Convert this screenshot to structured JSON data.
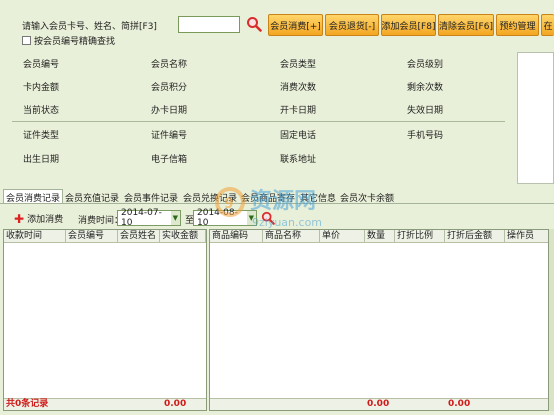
{
  "search": {
    "label": "请输入会员卡号、姓名、简拼[F3]",
    "value": "",
    "exact_label": "按会员编号精确查找"
  },
  "toolbar": [
    {
      "label": "会员消费[+]"
    },
    {
      "label": "会员退货[-]"
    },
    {
      "label": "添加会员[F8]"
    },
    {
      "label": "清除会员[F6]"
    },
    {
      "label": "预约管理"
    },
    {
      "label": "在"
    }
  ],
  "info": {
    "rows": [
      [
        "会员编号",
        "会员名称",
        "会员类型",
        "会员级别"
      ],
      [
        "卡内金额",
        "会员积分",
        "消费次数",
        "剩余次数"
      ],
      [
        "当前状态",
        "办卡日期",
        "开卡日期",
        "失效日期"
      ],
      [
        "证件类型",
        "证件编号",
        "固定电话",
        "手机号码"
      ],
      [
        "出生日期",
        "电子信箱",
        "联系地址",
        ""
      ]
    ]
  },
  "tabs": [
    {
      "label": "会员消费记录",
      "active": true
    },
    {
      "label": "会员充值记录",
      "active": false
    },
    {
      "label": "会员事件记录",
      "active": false
    },
    {
      "label": "会员兑换记录",
      "active": false
    },
    {
      "label": "会员商品寄存",
      "active": false
    },
    {
      "label": "其它信息",
      "active": false
    },
    {
      "label": "会员次卡余额",
      "active": false
    }
  ],
  "filter": {
    "add_label": "添加消费",
    "date_label": "消费时间：",
    "from_date": "2014-07-10",
    "to_label": "至",
    "to_date": "2014-08-10"
  },
  "left_grid": {
    "columns": [
      "收款时间",
      "会员编号",
      "会员姓名",
      "实收金额"
    ],
    "footer_count": "共0条记录",
    "footer_total": "0.00"
  },
  "right_grid": {
    "columns": [
      "商品编码",
      "商品名称",
      "单价",
      "数量",
      "打折比例",
      "打折后金额",
      "操作员"
    ],
    "footer_qty": "0.00",
    "footer_amount": "0.00"
  },
  "colors": {
    "background": "#e9f0d9",
    "button": "#f3a622",
    "footer_text": "#d01a1a"
  },
  "watermark": {
    "brand": "资源网",
    "url": "9ziyuan.com"
  }
}
